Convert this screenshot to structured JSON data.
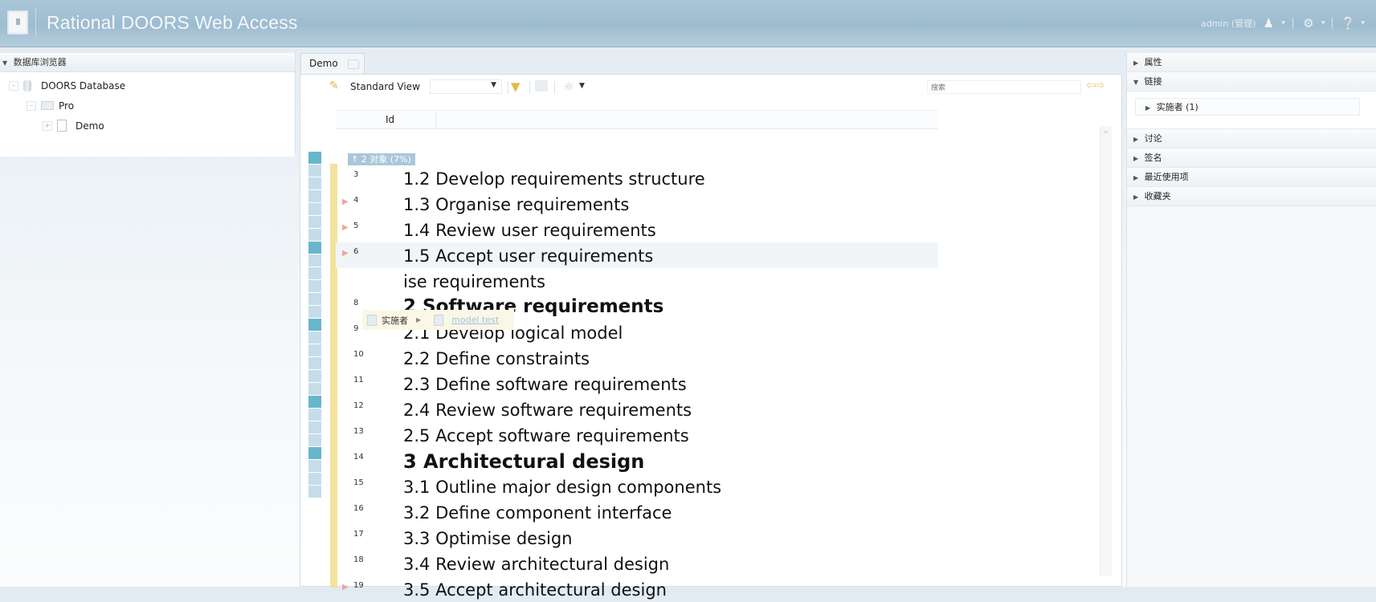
{
  "header": {
    "app_title": "Rational DOORS Web Access",
    "user": "admin (管理)",
    "icons": [
      "users-icon",
      "gear-icon",
      "help-icon"
    ]
  },
  "left_panel": {
    "title": "数据库浏览器",
    "tree": [
      {
        "label": "DOORS Database",
        "icon": "database-icon",
        "level": 0
      },
      {
        "label": "Pro",
        "icon": "folder-icon",
        "level": 1
      },
      {
        "label": "Demo",
        "icon": "document-icon",
        "level": 2
      }
    ]
  },
  "center": {
    "tab_label": "Demo",
    "view_name": "Standard View",
    "search_placeholder": "搜索",
    "column_id": "Id",
    "group_label": "↑ 2 对象 (7%)",
    "rows": [
      {
        "id": "3",
        "text": "1.2 Develop requirements structure",
        "marker": false,
        "style": "normal"
      },
      {
        "id": "4",
        "text": "1.3 Organise requirements",
        "marker": true,
        "style": "normal"
      },
      {
        "id": "5",
        "text": "1.4 Review user requirements",
        "marker": true,
        "style": "normal"
      },
      {
        "id": "6",
        "text": "1.5 Accept user requirements",
        "marker": true,
        "style": "normal"
      },
      {
        "id": "",
        "text": "ise requirements",
        "marker": false,
        "style": "normal"
      },
      {
        "id": "8",
        "text": "2 Software requirements",
        "marker": false,
        "style": "head"
      },
      {
        "id": "9",
        "text": "2.1 Develop logical model",
        "marker": false,
        "style": "normal"
      },
      {
        "id": "10",
        "text": "2.2 Define constraints",
        "marker": false,
        "style": "normal"
      },
      {
        "id": "11",
        "text": "2.3 Define software requirements",
        "marker": false,
        "style": "normal"
      },
      {
        "id": "12",
        "text": "2.4 Review software requirements",
        "marker": false,
        "style": "normal"
      },
      {
        "id": "13",
        "text": "2.5 Accept software requirements",
        "marker": false,
        "style": "normal"
      },
      {
        "id": "14",
        "text": "3 Architectural design",
        "marker": false,
        "style": "head"
      },
      {
        "id": "15",
        "text": "3.1 Outline major design components",
        "marker": false,
        "style": "normal"
      },
      {
        "id": "16",
        "text": "3.2 Define component interface",
        "marker": false,
        "style": "normal"
      },
      {
        "id": "17",
        "text": "3.3 Optimise design",
        "marker": false,
        "style": "normal"
      },
      {
        "id": "18",
        "text": "3.4 Review architectural design",
        "marker": false,
        "style": "normal"
      },
      {
        "id": "19",
        "text": "3.5 Accept architectural design",
        "marker": true,
        "style": "normal"
      }
    ],
    "link_popup": {
      "label": "实施者",
      "link": "model test"
    }
  },
  "right_panel": {
    "sections": [
      {
        "label": "属性",
        "expanded": false
      },
      {
        "label": "链接",
        "expanded": true
      },
      {
        "label": "讨论",
        "expanded": false
      },
      {
        "label": "签名",
        "expanded": false
      },
      {
        "label": "最近使用项",
        "expanded": false
      },
      {
        "label": "收藏夹",
        "expanded": false
      }
    ],
    "links_item": "实施者 (1)"
  }
}
